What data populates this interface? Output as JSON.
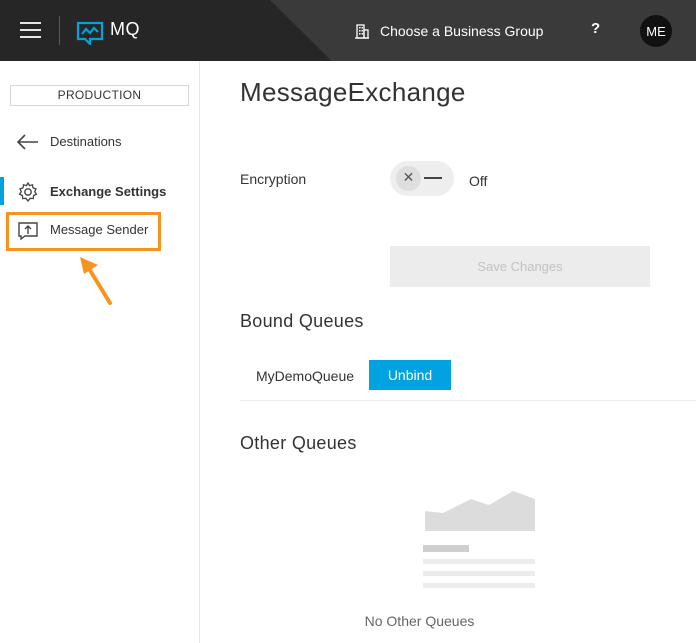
{
  "header": {
    "app_name": "MQ",
    "business_group_label": "Choose a Business Group",
    "help_label": "?",
    "user_initials": "ME"
  },
  "sidebar": {
    "environment": "PRODUCTION",
    "items": [
      {
        "label": "Destinations",
        "icon": "back-arrow-icon"
      },
      {
        "label": "Exchange Settings",
        "icon": "gear-icon",
        "active": true
      },
      {
        "label": "Message Sender",
        "icon": "message-send-icon",
        "highlighted": true
      }
    ]
  },
  "main": {
    "title": "MessageExchange",
    "encryption": {
      "label": "Encryption",
      "state": "Off"
    },
    "save_label": "Save Changes",
    "bound_queues": {
      "title": "Bound Queues",
      "rows": [
        {
          "name": "MyDemoQueue",
          "action": "Unbind"
        }
      ]
    },
    "other_queues": {
      "title": "Other Queues",
      "empty_text": "No Other Queues"
    }
  },
  "colors": {
    "accent": "#00a2df",
    "highlight": "#f7941d",
    "topbar": "#262626"
  }
}
